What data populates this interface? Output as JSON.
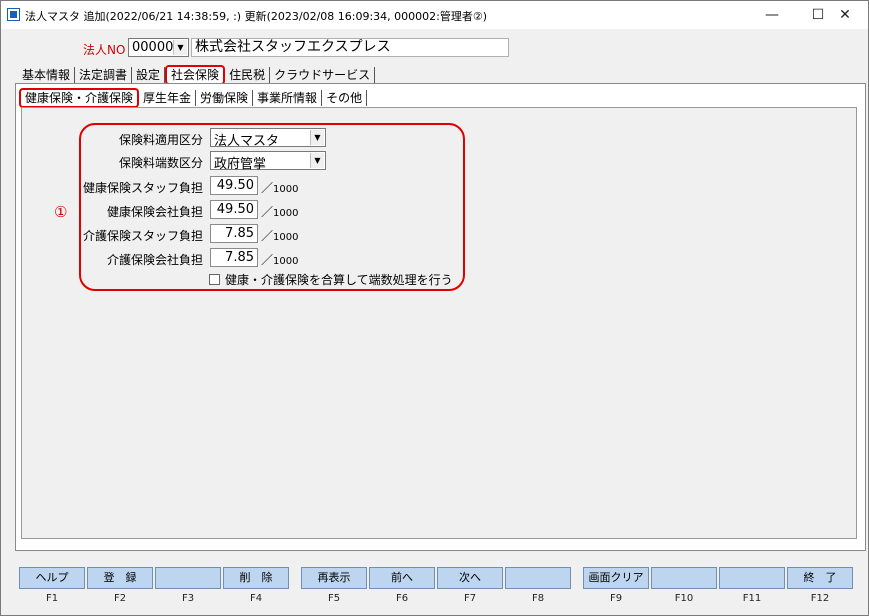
{
  "window": {
    "title": "法人マスタ 追加(2022/06/21 14:38:59, :) 更新(2023/02/08 16:09:34, 000002:管理者②)",
    "controls": {
      "minimize": "—",
      "maximize": "☐",
      "close": "✕"
    }
  },
  "corp": {
    "label": "法人NO",
    "code": "000001",
    "name": "株式会社スタッフエクスプレス"
  },
  "tabs": [
    "基本情報",
    "法定調書",
    "設定",
    "社会保険",
    "住民税",
    "クラウドサービス"
  ],
  "subtabs": [
    "健康保険・介護保険",
    "厚生年金",
    "労働保険",
    "事業所情報",
    "その他"
  ],
  "form": {
    "marker": "①",
    "application_label": "保険料適用区分",
    "application_value": "法人マスタ",
    "rounding_label": "保険料端数区分",
    "rounding_value": "政府管掌",
    "health_staff_label": "健康保険スタッフ負担",
    "health_staff_value": "49.50",
    "health_company_label": "健康保険会社負担",
    "health_company_value": "49.50",
    "care_staff_label": "介護保険スタッフ負担",
    "care_staff_value": "7.85",
    "care_company_label": "介護保険会社負担",
    "care_company_value": "7.85",
    "unit_slash": "／",
    "unit_base": "1000",
    "checkbox_label": "健康・介護保険を合算して端数処理を行う",
    "checkbox_checked": false
  },
  "fkeys": [
    {
      "label": "ヘルプ",
      "key": "F1"
    },
    {
      "label": "登　録",
      "key": "F2"
    },
    {
      "label": "",
      "key": "F3"
    },
    {
      "label": "削　除",
      "key": "F4"
    },
    {
      "label": "再表示",
      "key": "F5"
    },
    {
      "label": "前へ",
      "key": "F6"
    },
    {
      "label": "次へ",
      "key": "F7"
    },
    {
      "label": "",
      "key": "F8"
    },
    {
      "label": "画面クリア",
      "key": "F9"
    },
    {
      "label": "",
      "key": "F10"
    },
    {
      "label": "",
      "key": "F11"
    },
    {
      "label": "終　了",
      "key": "F12"
    }
  ],
  "colors": {
    "highlight": "#e00000",
    "fkey_button": "#bed5ef",
    "corp_label": "#d40000"
  }
}
